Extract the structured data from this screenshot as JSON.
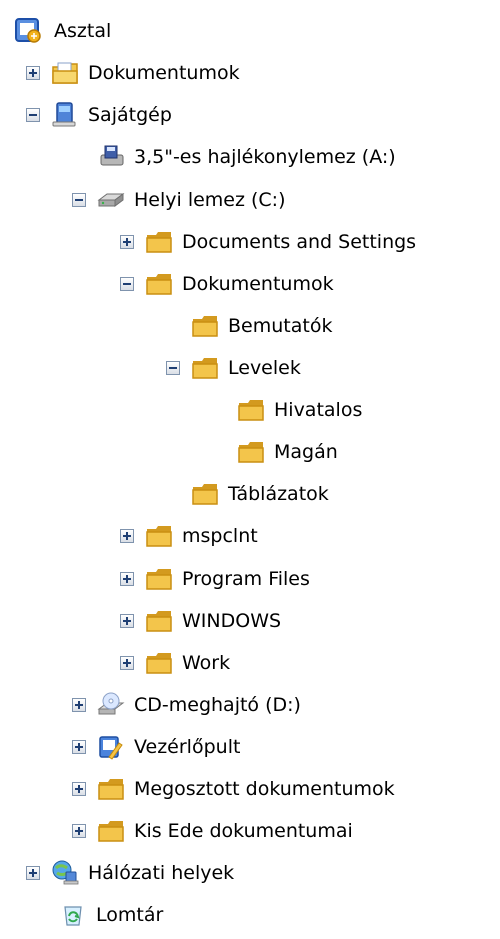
{
  "tree": {
    "items": [
      {
        "label": "Asztal",
        "icon": "desktop-icon",
        "expander": "none"
      },
      {
        "label": "Dokumentumok",
        "icon": "documents-icon",
        "expander": "collapsed"
      },
      {
        "label": "Sajátgép",
        "icon": "my-computer-icon",
        "expander": "expanded"
      },
      {
        "label": "3,5\"-es hajlékonylemez (A:)",
        "icon": "floppy-drive-icon",
        "expander": "none"
      },
      {
        "label": "Helyi lemez (C:)",
        "icon": "hard-drive-icon",
        "expander": "expanded"
      },
      {
        "label": "Documents and Settings",
        "icon": "folder-icon",
        "expander": "collapsed"
      },
      {
        "label": "Dokumentumok",
        "icon": "folder-icon",
        "expander": "expanded"
      },
      {
        "label": "Bemutatók",
        "icon": "folder-icon",
        "expander": "none"
      },
      {
        "label": "Levelek",
        "icon": "folder-icon",
        "expander": "expanded"
      },
      {
        "label": "Hivatalos",
        "icon": "folder-icon",
        "expander": "none"
      },
      {
        "label": "Magán",
        "icon": "folder-icon",
        "expander": "none"
      },
      {
        "label": "Táblázatok",
        "icon": "folder-icon",
        "expander": "none"
      },
      {
        "label": "mspclnt",
        "icon": "folder-icon",
        "expander": "collapsed"
      },
      {
        "label": "Program Files",
        "icon": "folder-icon",
        "expander": "collapsed"
      },
      {
        "label": "WINDOWS",
        "icon": "folder-icon",
        "expander": "collapsed"
      },
      {
        "label": "Work",
        "icon": "folder-icon",
        "expander": "collapsed"
      },
      {
        "label": "CD-meghajtó (D:)",
        "icon": "cd-drive-icon",
        "expander": "collapsed"
      },
      {
        "label": "Vezérlőpult",
        "icon": "control-panel-icon",
        "expander": "collapsed"
      },
      {
        "label": "Megosztott dokumentumok",
        "icon": "folder-icon",
        "expander": "collapsed"
      },
      {
        "label": "Kis Ede dokumentumai",
        "icon": "folder-icon",
        "expander": "collapsed"
      },
      {
        "label": "Hálózati helyek",
        "icon": "network-places-icon",
        "expander": "collapsed"
      },
      {
        "label": "Lomtár",
        "icon": "recycle-bin-icon",
        "expander": "none"
      }
    ]
  },
  "colors": {
    "folder": "#f3c54b",
    "folder_dark": "#d39a1f",
    "expander_border": "#7f93ad",
    "expander_sign": "#1f3f73"
  }
}
